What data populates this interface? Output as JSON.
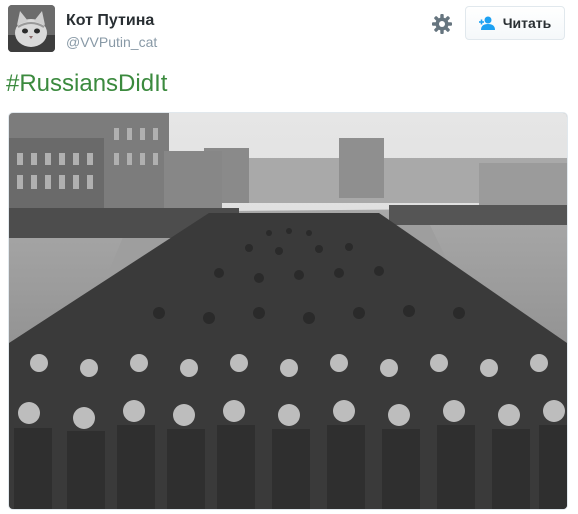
{
  "header": {
    "display_name": "Кот Путина",
    "handle": "@VVPutin_cat",
    "avatar_icon": "cat-avatar",
    "settings_icon": "gear-icon",
    "follow_label": "Читать",
    "follow_icon": "add-user-icon"
  },
  "tweet": {
    "hashtag": "#RussiansDidIt"
  },
  "colors": {
    "hashtag": "#3b8a3e",
    "name": "#292f33",
    "handle": "#8899a6",
    "follow_icon": "#1da1f2"
  }
}
